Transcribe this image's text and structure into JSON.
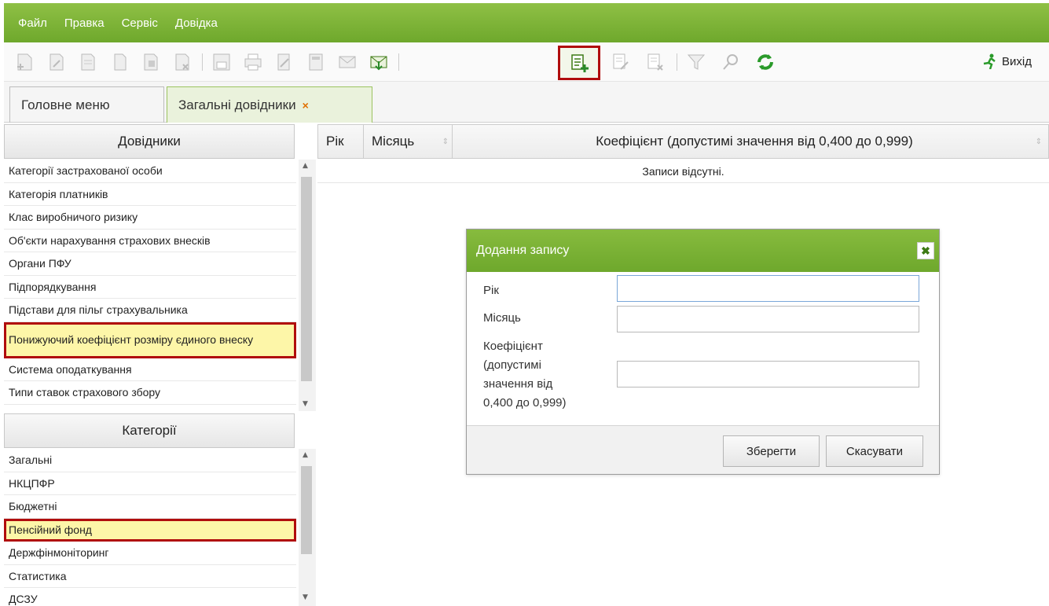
{
  "menu": {
    "file": "Файл",
    "edit": "Правка",
    "service": "Сервіс",
    "help": "Довідка"
  },
  "toolbar": {
    "exit_label": "Вихід",
    "highlighted": "add-record-icon"
  },
  "tabs": [
    {
      "label": "Головне меню"
    },
    {
      "label": "Загальні довідники",
      "close": "×"
    }
  ],
  "references": {
    "header": "Довідники",
    "items": [
      "Категорії застрахованої особи",
      "Категорія платників",
      "Клас виробничого ризику",
      "Об'єкти нарахування страхових внесків",
      "Органи ПФУ",
      "Підпорядкування",
      "Підстави для пільг страхувальника",
      "Понижуючий коефіцієнт розміру єдиного внеску",
      "Система оподаткування",
      "Типи ставок страхового збору"
    ],
    "selected_index": 7
  },
  "categories": {
    "header": "Категорії",
    "items": [
      "Загальні",
      "НКЦПФР",
      "Бюджетні",
      "Пенсійний фонд",
      "Держфінмоніторинг",
      "Статистика",
      "ДСЗУ"
    ],
    "selected_index": 3
  },
  "grid": {
    "col_year": "Рік",
    "col_month": "Місяць",
    "col_coef": "Коефіцієнт (допустимі значення від 0,400 до 0,999)",
    "empty": "Записи відсутні."
  },
  "dialog": {
    "title": "Додання запису",
    "close": "✖",
    "year_label": "Рік",
    "month_label": "Місяць",
    "coef_label_1": "Коефіцієнт",
    "coef_label_2": "(допустимі",
    "coef_label_3": "значення від",
    "coef_label_4": "0,400 до 0,999)",
    "year_value": "",
    "month_value": "",
    "coef_value": "",
    "save": "Зберегти",
    "cancel": "Скасувати"
  },
  "colors": {
    "green": "#6ea82c",
    "highlight_border": "#b00d0d",
    "selected_bg": "#fdf6a8"
  }
}
